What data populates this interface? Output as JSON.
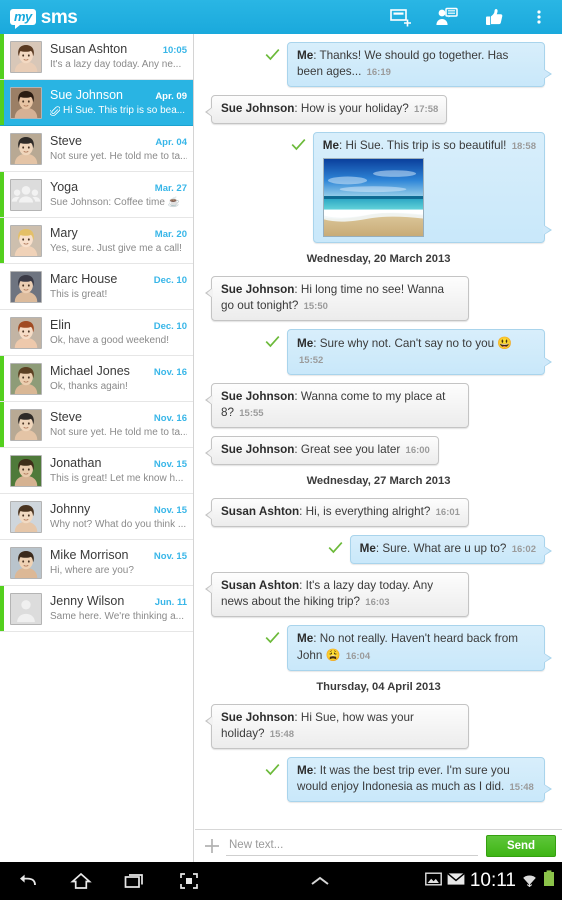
{
  "app": {
    "logo_my": "my",
    "logo_sms": "sms"
  },
  "toolbar": {
    "new_message_label": "new-message",
    "broadcast_label": "group-message",
    "thumbs_up_label": "thumbs-up",
    "overflow_label": "more-options"
  },
  "conversations": [
    {
      "name": "Susan Ashton",
      "date": "10:05",
      "preview": "It's a lazy day today. Any ne...",
      "unread": true,
      "selected": false,
      "attachment": false,
      "avatar": "woman-brown-hair"
    },
    {
      "name": "Sue Johnson",
      "date": "Apr. 09",
      "preview": "Hi Sue. This trip is so bea...",
      "unread": true,
      "selected": true,
      "attachment": true,
      "avatar": "woman-glasses"
    },
    {
      "name": "Steve",
      "date": "Apr. 04",
      "preview": "Not sure yet. He told me to ta...",
      "unread": false,
      "selected": false,
      "attachment": false,
      "avatar": "man-cap"
    },
    {
      "name": "Yoga",
      "date": "Mar. 27",
      "preview": "Sue Johnson: Coffee time ☕",
      "unread": true,
      "selected": false,
      "attachment": false,
      "avatar": "group"
    },
    {
      "name": "Mary",
      "date": "Mar. 20",
      "preview": "Yes, sure. Just give me a call!",
      "unread": true,
      "selected": false,
      "attachment": false,
      "avatar": "blonde-woman"
    },
    {
      "name": "Marc House",
      "date": "Dec. 10",
      "preview": "This is great!",
      "unread": false,
      "selected": false,
      "attachment": false,
      "avatar": "man-suit"
    },
    {
      "name": "Elin",
      "date": "Dec. 10",
      "preview": "Ok, have a good weekend!",
      "unread": false,
      "selected": false,
      "attachment": false,
      "avatar": "redhead-woman"
    },
    {
      "name": "Michael Jones",
      "date": "Nov. 16",
      "preview": "Ok, thanks again!",
      "unread": true,
      "selected": false,
      "attachment": false,
      "avatar": "young-man"
    },
    {
      "name": "Steve",
      "date": "Nov. 16",
      "preview": "Not sure yet. He told me to ta...",
      "unread": true,
      "selected": false,
      "attachment": false,
      "avatar": "man-cap"
    },
    {
      "name": "Jonathan",
      "date": "Nov. 15",
      "preview": "This is great! Let me know h...",
      "unread": false,
      "selected": false,
      "attachment": false,
      "avatar": "man-green"
    },
    {
      "name": "Johnny",
      "date": "Nov. 15",
      "preview": "Why not? What do you think ...",
      "unread": false,
      "selected": false,
      "attachment": false,
      "avatar": "man-shirt"
    },
    {
      "name": "Mike Morrison",
      "date": "Nov. 15",
      "preview": "Hi, where are you?",
      "unread": false,
      "selected": false,
      "attachment": false,
      "avatar": "curly-man"
    },
    {
      "name": "Jenny Wilson",
      "date": "Jun. 11",
      "preview": "Same here. We're thinking a...",
      "unread": true,
      "selected": false,
      "attachment": false,
      "avatar": "placeholder"
    }
  ],
  "chat": {
    "items": [
      {
        "kind": "message",
        "dir": "out",
        "sender": "Me",
        "text": "Thanks! We should go together. Has been ages...",
        "time": "16:19",
        "photo": false,
        "emoji": ""
      },
      {
        "kind": "message",
        "dir": "in",
        "sender": "Sue Johnson",
        "text": "How is your holiday?",
        "time": "17:58",
        "photo": false,
        "emoji": ""
      },
      {
        "kind": "message",
        "dir": "out",
        "sender": "Me",
        "text": "Hi Sue. This trip is so beautiful!",
        "time": "18:58",
        "photo": true,
        "emoji": ""
      },
      {
        "kind": "date",
        "label": "Wednesday, 20 March 2013"
      },
      {
        "kind": "message",
        "dir": "in",
        "sender": "Sue Johnson",
        "text": "Hi long time no see! Wanna go out tonight?",
        "time": "15:50",
        "photo": false,
        "emoji": ""
      },
      {
        "kind": "message",
        "dir": "out",
        "sender": "Me",
        "text": "Sure why not. Can't say no to you",
        "time": "15:52",
        "photo": false,
        "emoji": "😃"
      },
      {
        "kind": "message",
        "dir": "in",
        "sender": "Sue Johnson",
        "text": "Wanna come to my place at 8?",
        "time": "15:55",
        "photo": false,
        "emoji": ""
      },
      {
        "kind": "message",
        "dir": "in",
        "sender": "Sue Johnson",
        "text": "Great see you later",
        "time": "16:00",
        "photo": false,
        "emoji": ""
      },
      {
        "kind": "date",
        "label": "Wednesday, 27 March 2013"
      },
      {
        "kind": "message",
        "dir": "in",
        "sender": "Susan Ashton",
        "text": "Hi, is everything alright?",
        "time": "16:01",
        "photo": false,
        "emoji": ""
      },
      {
        "kind": "message",
        "dir": "out",
        "sender": "Me",
        "text": "Sure. What are u up to?",
        "time": "16:02",
        "photo": false,
        "emoji": ""
      },
      {
        "kind": "message",
        "dir": "in",
        "sender": "Susan Ashton",
        "text": "It's a lazy day today. Any news about the hiking trip?",
        "time": "16:03",
        "photo": false,
        "emoji": ""
      },
      {
        "kind": "message",
        "dir": "out",
        "sender": "Me",
        "text": "No not really. Haven't heard back from John",
        "time": "16:04",
        "photo": false,
        "emoji": "😩"
      },
      {
        "kind": "date",
        "label": "Thursday, 04 April 2013"
      },
      {
        "kind": "message",
        "dir": "in",
        "sender": "Sue Johnson",
        "text": "Hi Sue, how was your holiday?",
        "time": "15:48",
        "photo": false,
        "emoji": ""
      },
      {
        "kind": "message",
        "dir": "out",
        "sender": "Me",
        "text": "It was the best trip ever. I'm sure you would enjoy Indonesia as much as I did.",
        "time": "15:48",
        "photo": false,
        "emoji": ""
      }
    ]
  },
  "composer": {
    "placeholder": "New text...",
    "value": "",
    "send_label": "Send",
    "attach_label": "add-attachment"
  },
  "navbar": {
    "back_label": "back",
    "home_label": "home",
    "recents_label": "recent-apps",
    "screenshot_label": "screenshot",
    "expand_label": "expand",
    "clock": "10:11",
    "status_icons": [
      "image-icon",
      "envelope-icon",
      "wifi-icon",
      "battery-icon"
    ]
  },
  "colors": {
    "accent": "#29b4e3",
    "unread_marker": "#54d01e",
    "send_green": "#3fb515",
    "out_bubble": "#cfe9fa",
    "in_bubble": "#f2f2f2",
    "date_text": "#38b6e8"
  }
}
